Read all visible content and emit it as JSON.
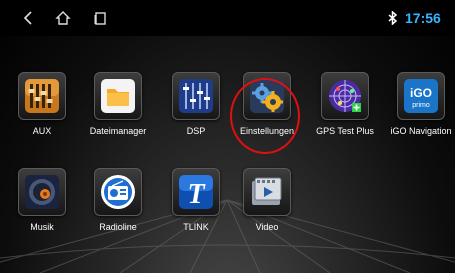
{
  "statusbar": {
    "clock": "17:56",
    "bluetooth_icon": "bluetooth-icon",
    "accent_color": "#33b5ff"
  },
  "apps": {
    "row1": [
      {
        "label": "AUX",
        "icon": "equalizer-sliders-icon"
      },
      {
        "label": "Dateimanager",
        "icon": "folder-icon"
      },
      {
        "label": "DSP",
        "icon": "dsp-sliders-icon"
      },
      {
        "label": "Einstellungen",
        "icon": "gears-icon"
      },
      {
        "label": "GPS Test Plus",
        "icon": "gps-radar-icon"
      },
      {
        "label": "iGO Navigation",
        "icon": "igo-primo-icon",
        "icon_text": "iGO",
        "icon_subtext": "primo"
      }
    ],
    "row2": [
      {
        "label": "Musik",
        "icon": "speaker-icon"
      },
      {
        "label": "Radioline",
        "icon": "radio-icon"
      },
      {
        "label": "TLINK",
        "icon": "tlink-icon",
        "icon_text": "T"
      },
      {
        "label": "Video",
        "icon": "film-icon"
      }
    ]
  },
  "highlight_color": "#e01010"
}
